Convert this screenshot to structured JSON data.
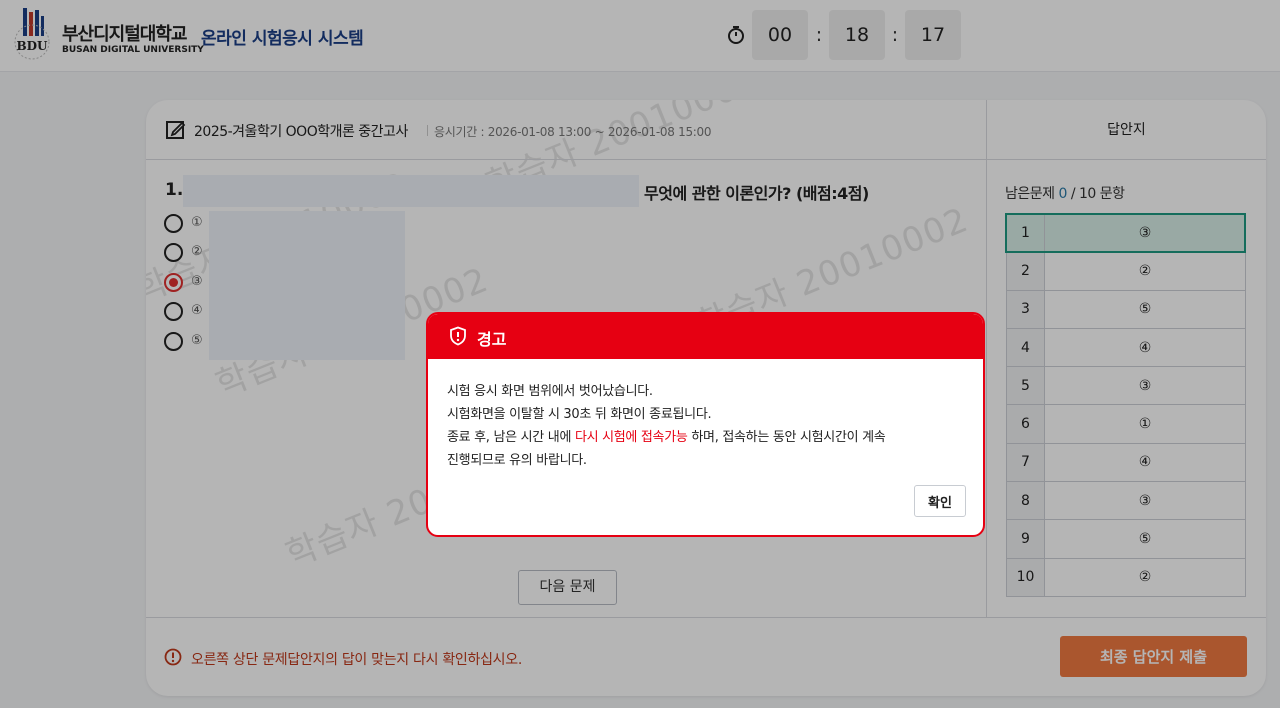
{
  "header": {
    "logo_mark": "BDU",
    "logo_ko": "부산디지털대학교",
    "logo_en": "BUSAN DIGITAL UNIVERSITY",
    "system_title": "온라인 시험응시 시스템",
    "timer": {
      "hours": "00",
      "minutes": "18",
      "seconds": "17",
      "separator": ":"
    }
  },
  "exam": {
    "title": "2025-겨울학기 OOO학개론 중간고사",
    "period": "응시기간 : 2026-01-08 13:00 ~ 2026-01-08 15:00"
  },
  "question": {
    "number": "1.",
    "text": "무엇에 관한 이론인가? (배점:4점)",
    "options": [
      {
        "num": "①",
        "selected": false
      },
      {
        "num": "②",
        "selected": false
      },
      {
        "num": "③",
        "selected": true
      },
      {
        "num": "④",
        "selected": false
      },
      {
        "num": "⑤",
        "selected": false
      }
    ],
    "next_label": "다음 문제"
  },
  "watermark": "학습자 20010002",
  "answer_sheet": {
    "title": "답안지",
    "remain_prefix": "남은문제",
    "remain_count": "0",
    "remain_suffix": "/ 10 문항",
    "active_row": 1,
    "rows": [
      {
        "no": "1",
        "answer": "③"
      },
      {
        "no": "2",
        "answer": "②"
      },
      {
        "no": "3",
        "answer": "⑤"
      },
      {
        "no": "4",
        "answer": "④"
      },
      {
        "no": "5",
        "answer": "③"
      },
      {
        "no": "6",
        "answer": "①"
      },
      {
        "no": "7",
        "answer": "④"
      },
      {
        "no": "8",
        "answer": "③"
      },
      {
        "no": "9",
        "answer": "⑤"
      },
      {
        "no": "10",
        "answer": "②"
      }
    ]
  },
  "footer": {
    "warning": "오른쪽 상단 문제답안지의 답이 맞는지 다시 확인하십시오.",
    "submit_label": "최종 답안지 제출"
  },
  "modal": {
    "title": "경고",
    "line1": "시험 응시 화면 범위에서 벗어났습니다.",
    "line2": "시험화면을 이탈할 시 30초 뒤 화면이 종료됩니다.",
    "line3_pre": "종료 후, 남은 시간 내에 ",
    "line3_highlight": "다시 시험에 접속가능",
    "line3_post": " 하며, 접속하는 동안 시험시간이 계속",
    "line4": "진행되므로 유의 바랍니다.",
    "ok_label": "확인"
  },
  "colors": {
    "brand_blue": "#1b3f86",
    "alert_red": "#e60012",
    "submit_orange": "#f07a42",
    "warn_text": "#c0391b",
    "active_row_border": "#1e9a82",
    "remain_count": "#2a7aa8"
  },
  "icons": {
    "timer": "stopwatch-icon",
    "edit": "edit-icon",
    "warning": "alert-circle-icon",
    "modal": "shield-alert-icon"
  }
}
